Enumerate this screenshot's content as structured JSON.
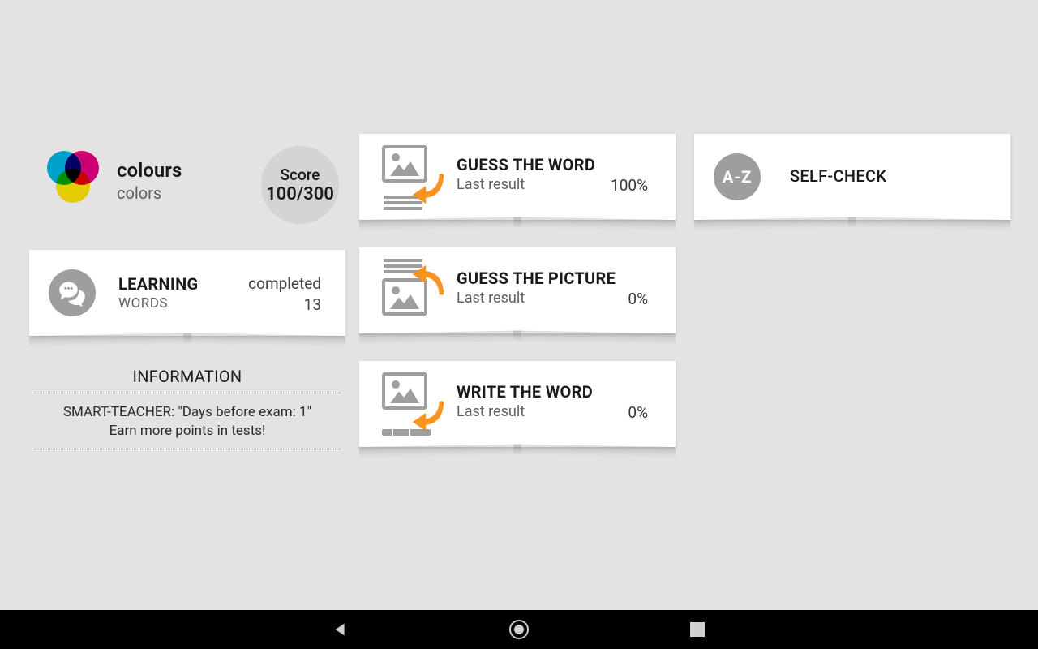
{
  "header": {
    "title": "colours",
    "subtitle": "colors"
  },
  "score": {
    "label": "Score",
    "value": "100/300"
  },
  "learning": {
    "title": "LEARNING",
    "subtitle": "WORDS",
    "status_label": "completed",
    "status_value": "13"
  },
  "info": {
    "heading": "INFORMATION",
    "line1": "SMART-TEACHER: \"Days before exam: 1\"",
    "line2": "Earn more points in tests!"
  },
  "games": {
    "guess_word": {
      "title": "GUESS THE WORD",
      "subtitle": "Last result",
      "percent": "100%"
    },
    "guess_picture": {
      "title": "GUESS THE PICTURE",
      "subtitle": "Last result",
      "percent": "0%"
    },
    "write_word": {
      "title": "WRITE THE WORD",
      "subtitle": "Last result",
      "percent": "0%"
    }
  },
  "selfcheck": {
    "badge": "A-Z",
    "title": "SELF-CHECK"
  }
}
